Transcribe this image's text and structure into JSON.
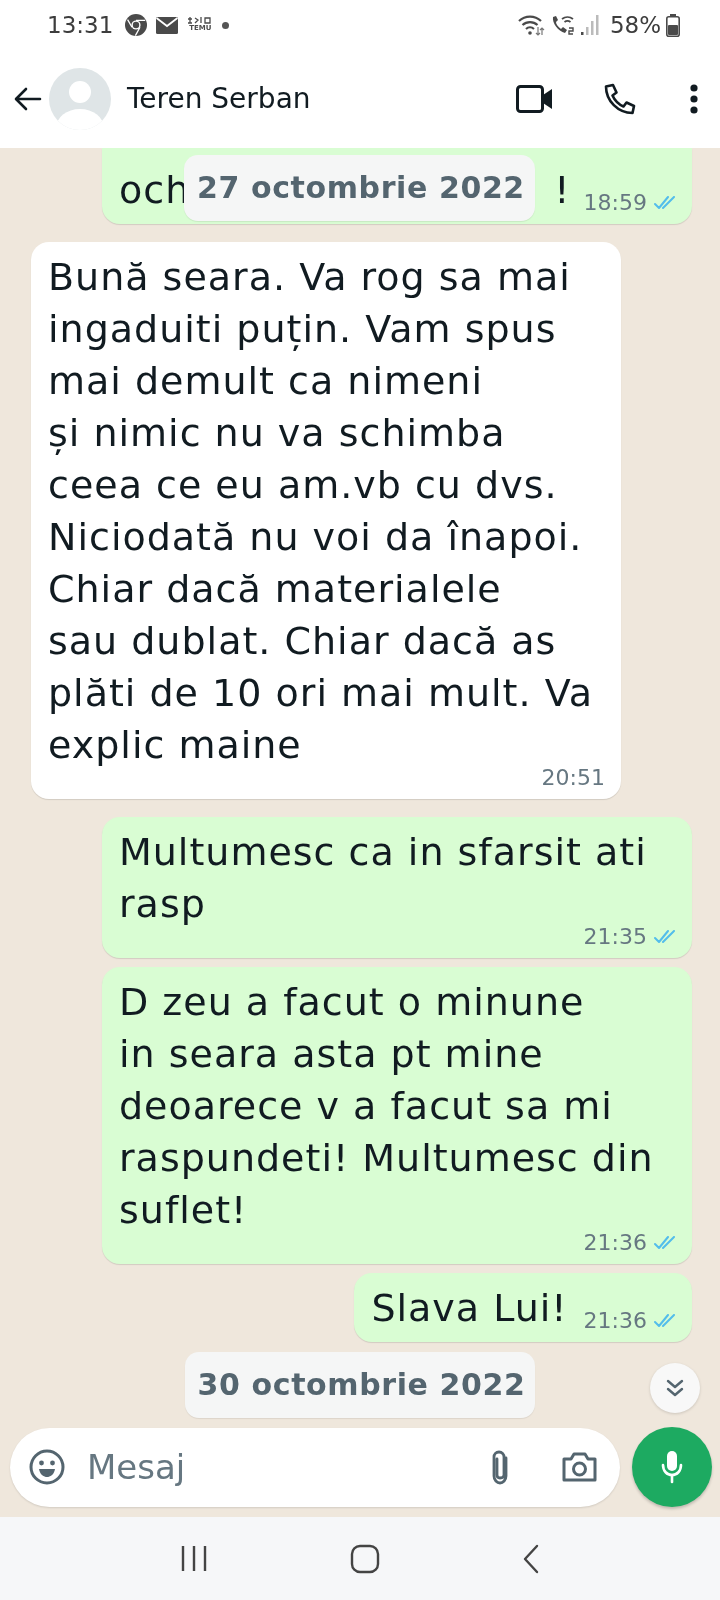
{
  "status_bar": {
    "time": "13:31",
    "app_badge_text": "TEMU",
    "battery": "58%"
  },
  "header": {
    "contact_name": "Teren Serban"
  },
  "sticky_date": "27 octombrie 2022",
  "messages": [
    {
      "kind": "message",
      "outgoing": true,
      "fragments": [
        "och",
        "!"
      ],
      "time": "18:59",
      "read": true
    },
    {
      "kind": "message",
      "outgoing": false,
      "text": "Bună seara. Va rog sa mai ingaduiti puțin. Vam spus mai demult ca nimeni\nși nimic nu va schimba\nceea ce eu am.vb cu dvs. Niciodată nu voi da înapoi. Chiar dacă materialele\nsau dublat. Chiar dacă as plăti de 10 ori mai mult. Va explic maine",
      "time": "20:51"
    },
    {
      "kind": "message",
      "outgoing": true,
      "text": "Multumesc ca in sfarsit ati rasp",
      "time": "21:35",
      "read": true
    },
    {
      "kind": "message",
      "outgoing": true,
      "text": "D zeu a facut o minune\nin seara asta pt mine\ndeoarece v a facut sa mi raspundeti! Multumesc din suflet!",
      "time": "21:36",
      "read": true
    },
    {
      "kind": "message",
      "outgoing": true,
      "text": "Slava Lui!",
      "time": "21:36",
      "read": true
    },
    {
      "kind": "date",
      "label": "30 octombrie 2022"
    }
  ],
  "composer": {
    "placeholder": "Mesaj"
  }
}
